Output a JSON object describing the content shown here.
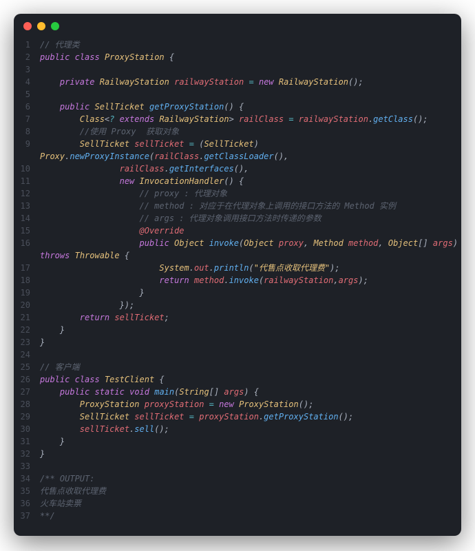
{
  "window": {
    "traffic_lights": [
      "red",
      "yellow",
      "green"
    ]
  },
  "code": {
    "lines": [
      {
        "n": 1,
        "html": "<span class='comment'>// 代理类</span>"
      },
      {
        "n": 2,
        "html": "<span class='keyword'>public</span> <span class='keyword'>class</span> <span class='type'>ProxyStation</span> {"
      },
      {
        "n": 3,
        "html": ""
      },
      {
        "n": 4,
        "html": "    <span class='keyword'>private</span> <span class='type'>RailwayStation</span> <span class='var'>railwayStation</span> <span class='operator'>=</span> <span class='newkw'>new</span> <span class='type'>RailwayStation</span>();"
      },
      {
        "n": 5,
        "html": ""
      },
      {
        "n": 6,
        "html": "    <span class='keyword'>public</span> <span class='type'>SellTicket</span> <span class='method'>getProxyStation</span>() {"
      },
      {
        "n": 7,
        "html": "        <span class='type'>Class</span>&lt;<span class='operator'>?</span> <span class='keyword'>extends</span> <span class='type'>RailwayStation</span>&gt; <span class='var'>railClass</span> <span class='operator'>=</span> <span class='var'>railwayStation</span>.<span class='method'>getClass</span>();"
      },
      {
        "n": 8,
        "html": "        <span class='comment'>//使用 Proxy  获取对象</span>"
      },
      {
        "n": 9,
        "html": "        <span class='type'>SellTicket</span> <span class='var'>sellTicket</span> <span class='operator'>=</span> (<span class='type'>SellTicket</span>) "
      },
      {
        "n": "",
        "html": "<span class='type'>Proxy</span>.<span class='method'>newProxyInstance</span>(<span class='var'>railClass</span>.<span class='method'>getClassLoader</span>(),"
      },
      {
        "n": 10,
        "html": "                <span class='var'>railClass</span>.<span class='method'>getInterfaces</span>(),"
      },
      {
        "n": 11,
        "html": "                <span class='newkw'>new</span> <span class='type'>InvocationHandler</span>() {"
      },
      {
        "n": 12,
        "html": "                    <span class='comment'>// proxy : 代理对象</span>"
      },
      {
        "n": 13,
        "html": "                    <span class='comment'>// method : 对应于在代理对象上调用的接口方法的 Method 实例</span>"
      },
      {
        "n": 14,
        "html": "                    <span class='comment'>// args : 代理对象调用接口方法时传递的参数</span>"
      },
      {
        "n": 15,
        "html": "                    <span class='annotation'>@Override</span>"
      },
      {
        "n": 16,
        "html": "                    <span class='keyword'>public</span> <span class='type'>Object</span> <span class='method'>invoke</span>(<span class='type'>Object</span> <span class='var'>proxy</span>, <span class='type'>Method</span> <span class='var'>method</span>, <span class='type'>Object</span>[] <span class='var'>args</span>) "
      },
      {
        "n": "",
        "html": "<span class='keyword'>throws</span> <span class='type'>Throwable</span> {"
      },
      {
        "n": 17,
        "html": "                        <span class='type'>System</span>.<span class='var'>out</span>.<span class='method'>println</span>(<span class='string'>\"代售点收取代理费\"</span>);"
      },
      {
        "n": 18,
        "html": "                        <span class='keyword'>return</span> <span class='var'>method</span>.<span class='method'>invoke</span>(<span class='var'>railwayStation</span>,<span class='var'>args</span>);"
      },
      {
        "n": 19,
        "html": "                    }"
      },
      {
        "n": 20,
        "html": "                });"
      },
      {
        "n": 21,
        "html": "        <span class='keyword'>return</span> <span class='var'>sellTicket</span>;"
      },
      {
        "n": 22,
        "html": "    }"
      },
      {
        "n": 23,
        "html": "}"
      },
      {
        "n": 24,
        "html": ""
      },
      {
        "n": 25,
        "html": "<span class='comment'>// 客户端</span>"
      },
      {
        "n": 26,
        "html": "<span class='keyword'>public</span> <span class='keyword'>class</span> <span class='type'>TestClient</span> {"
      },
      {
        "n": 27,
        "html": "    <span class='keyword'>public</span> <span class='keyword'>static</span> <span class='keyword'>void</span> <span class='method'>main</span>(<span class='type'>String</span>[] <span class='var'>args</span>) {"
      },
      {
        "n": 28,
        "html": "        <span class='type'>ProxyStation</span> <span class='var'>proxyStation</span> <span class='operator'>=</span> <span class='newkw'>new</span> <span class='type'>ProxyStation</span>();"
      },
      {
        "n": 29,
        "html": "        <span class='type'>SellTicket</span> <span class='var'>sellTicket</span> <span class='operator'>=</span> <span class='var'>proxyStation</span>.<span class='method'>getProxyStation</span>();"
      },
      {
        "n": 30,
        "html": "        <span class='var'>sellTicket</span>.<span class='method'>sell</span>();"
      },
      {
        "n": 31,
        "html": "    }"
      },
      {
        "n": 32,
        "html": "}"
      },
      {
        "n": 33,
        "html": ""
      },
      {
        "n": 34,
        "html": "<span class='comment'>/** OUTPUT:</span>"
      },
      {
        "n": 35,
        "html": "<span class='comment'>代售点收取代理费</span>"
      },
      {
        "n": 36,
        "html": "<span class='comment'>火车站卖票</span>"
      },
      {
        "n": 37,
        "html": "<span class='comment'>**/</span>"
      }
    ]
  }
}
